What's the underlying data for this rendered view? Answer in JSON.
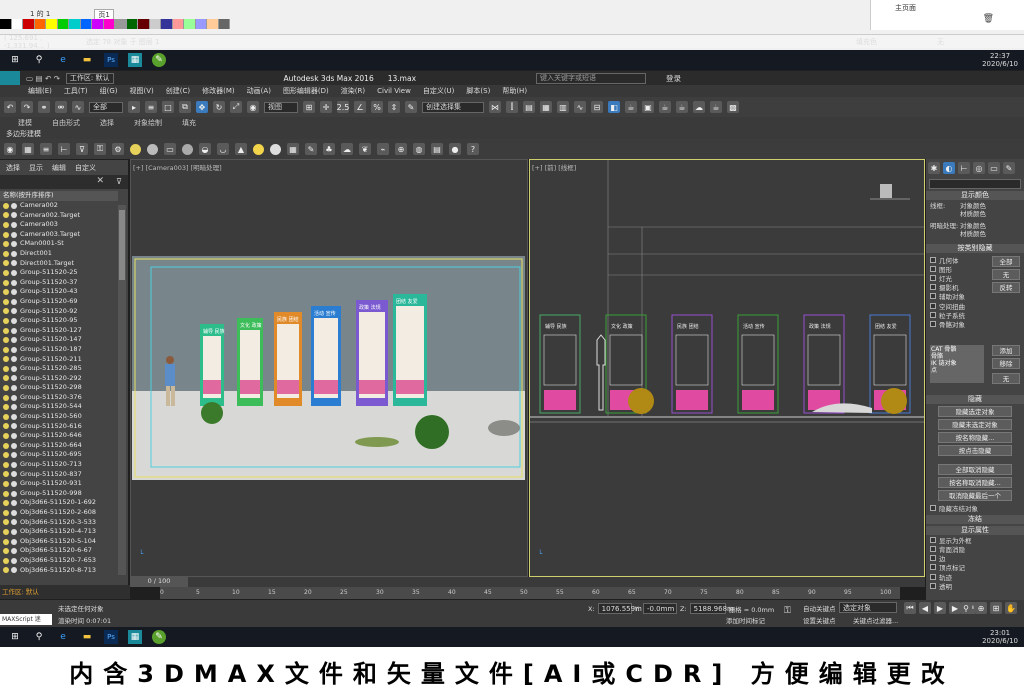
{
  "corel": {
    "page_tab": "页1",
    "page_nav": "1 的 1",
    "coords": "( 125.691 , -1,331.94… )",
    "status": "选定 78 对象 于 图层 1",
    "fill_label": "填充色",
    "outline_label": "无",
    "page_name": "主页面",
    "palette_colors": [
      "#000",
      "#fff",
      "#c00",
      "#f60",
      "#ff0",
      "#0c0",
      "#0cc",
      "#06f",
      "#c0f",
      "#f0c",
      "#999",
      "#060",
      "#600",
      "#ccc",
      "#339",
      "#f99",
      "#9f9",
      "#99f",
      "#fc9",
      "#666"
    ]
  },
  "taskbar_top": {
    "time": "22:37",
    "date": "2020/6/10"
  },
  "taskbar_bottom": {
    "time": "23:01",
    "date": "2020/6/10"
  },
  "max": {
    "title": "Autodesk 3ds Max 2016",
    "file": "13.max",
    "workspace": "工作区: 默认",
    "search_placeholder": "键入关键字或短语",
    "login": "登录",
    "menu": [
      "编辑(E)",
      "工具(T)",
      "组(G)",
      "视图(V)",
      "创建(C)",
      "修改器(M)",
      "动画(A)",
      "图形编辑器(D)",
      "渲染(R)",
      "Civil View",
      "自定义(U)",
      "脚本(S)",
      "帮助(H)"
    ],
    "select_filter": "全部",
    "ref_coord": "视图",
    "selection_set": "创建选择集",
    "ribbon_tabs": [
      "建模",
      "自由形式",
      "选择",
      "对象绘制",
      "填充"
    ],
    "ribbon_sub": "多边形建模",
    "explorer_menu": [
      "选择",
      "显示",
      "编辑",
      "自定义"
    ],
    "explorer_header": "名称(按升序排序)",
    "objects": [
      "Camera002",
      "Camera002.Target",
      "Camera003",
      "Camera003.Target",
      "CMan0001-St",
      "Direct001",
      "Direct001.Target",
      "Group-511520-25",
      "Group-511520-37",
      "Group-511520-43",
      "Group-511520-69",
      "Group-511520-92",
      "Group-511520-95",
      "Group-511520-127",
      "Group-511520-147",
      "Group-511520-187",
      "Group-511520-211",
      "Group-511520-285",
      "Group-511520-292",
      "Group-511520-298",
      "Group-511520-376",
      "Group-511520-544",
      "Group-511520-560",
      "Group-511520-616",
      "Group-511520-646",
      "Group-511520-664",
      "Group-511520-695",
      "Group-511520-713",
      "Group-511520-837",
      "Group-511520-931",
      "Group-511520-998",
      "Obj3d66-511520-1-692",
      "Obj3d66-511520-2-608",
      "Obj3d66-511520-3-533",
      "Obj3d66-511520-4-713",
      "Obj3d66-511520-5-104",
      "Obj3d66-511520-6-67",
      "Obj3d66-511520-7-653",
      "Obj3d66-511520-8-713"
    ],
    "vp_left_label": "[+] [Camera003] [明暗处理]",
    "vp_right_label": "[+] [前] [线框]",
    "panel": {
      "display_color": "显示颜色",
      "wireframe": "线框:",
      "shaded": "明暗处理:",
      "obj_color": "对象颜色",
      "mat_color": "材质颜色",
      "hide_by_cat": "按类别隐藏",
      "cats": [
        "几何体",
        "图形",
        "灯光",
        "摄影机",
        "辅助对象",
        "空间扭曲",
        "粒子系统",
        "骨骼对象"
      ],
      "all": "全部",
      "none": "无",
      "invert": "反转",
      "list_items": [
        "CAT 骨骼",
        "骨骼",
        "IK 链对象",
        "点"
      ],
      "add": "添加",
      "remove": "移除",
      "none2": "无",
      "hide_title": "隐藏",
      "hide_btns": [
        "隐藏选定对象",
        "隐藏未选定对象",
        "按名称隐藏...",
        "按点击隐藏"
      ],
      "unhide_btns": [
        "全部取消隐藏",
        "按名称取消隐藏...",
        "取消隐藏最后一个"
      ],
      "hide_frozen": "隐藏冻结对象",
      "freeze_title": "冻结",
      "display_props": "显示属性",
      "props": [
        "显示为外框",
        "背面消隐",
        "边",
        "顶点标记",
        "轨迹",
        "透明"
      ]
    },
    "timeline": "0 / 100",
    "ruler_ticks": [
      "0",
      "5",
      "10",
      "15",
      "20",
      "25",
      "30",
      "35",
      "40",
      "45",
      "50",
      "55",
      "60",
      "65",
      "70",
      "75",
      "80",
      "85",
      "90",
      "95",
      "100"
    ],
    "status_workspace": "工作区: 默认",
    "status_msg": "未选定任何对象",
    "render_time": "渲染时间 0:07:01",
    "maxscript": "MAXScript 迷",
    "x_label": "X:",
    "x_val": "1076.559m",
    "y_label": "Y:",
    "y_val": "-0.0mm",
    "z_label": "Z:",
    "z_val": "5188.968m",
    "grid": "栅格 = 0.0mm",
    "add_time_tag": "添加时间标记",
    "auto_key": "自动关键点",
    "set_key": "设置关键点",
    "selected_obj": "选定对象",
    "key_filter": "关键点过滤器..."
  },
  "signs": [
    "辅导 民族",
    "文化 政策",
    "民族 团结",
    "活动 宣传",
    "政策 法规",
    "团结 友爱"
  ],
  "caption": "内含3DMAX文件和矢量文件[AI或CDR] 方便编辑更改"
}
